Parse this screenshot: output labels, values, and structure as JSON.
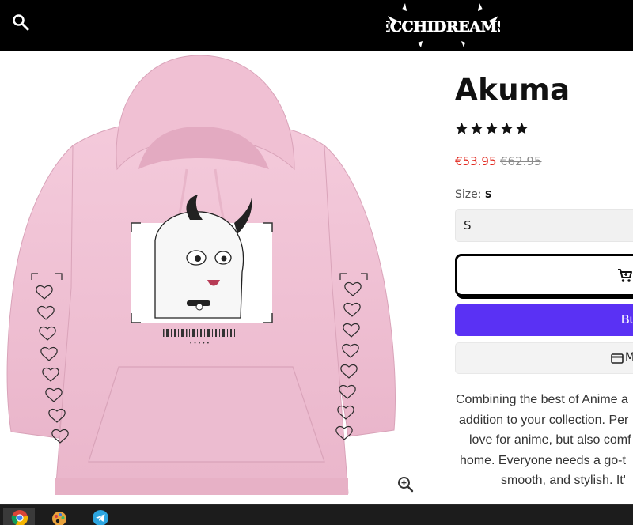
{
  "header": {
    "search_icon": "search-icon",
    "logo_text": "ECCHIDREAMS"
  },
  "product": {
    "title": "Akuma",
    "rating": {
      "value": 5,
      "max": 5
    },
    "price_sale": "€53.95",
    "price_compare": "€62.95",
    "size_label": "Size:",
    "size_value": "S",
    "size_selected": "S",
    "add_to_cart_icon": "cart-icon",
    "buy_now_label": "Buy",
    "more_payment_label": "M",
    "description_lines": [
      "Combining the best of Anime a",
      "addition to your collection. Per",
      "love for anime, but also comf",
      "home. Everyone needs a go-t",
      "smooth, and stylish. It'"
    ]
  },
  "gallery": {
    "zoom_icon": "zoom-in-icon",
    "print_caption": "• • • • •"
  },
  "taskbar": {
    "items": [
      "chrome-icon",
      "paint-icon",
      "telegram-icon"
    ]
  },
  "colors": {
    "header_bg": "#000000",
    "sale_price": "#e1251b",
    "buy_button": "#5a31f4",
    "hoodie": "#f2c4d6"
  }
}
